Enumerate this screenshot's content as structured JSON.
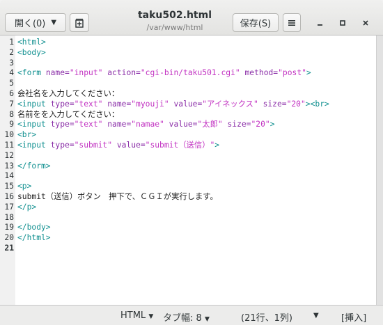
{
  "window": {
    "title": "taku502.html",
    "subtitle": "/var/www/html",
    "open_label": "開く(0)",
    "save_label": "保存(S)",
    "menu_icon": "hamburger-icon",
    "new_tab_icon": "new-document-icon"
  },
  "editor": {
    "current_line": 21,
    "lines": [
      {
        "n": "1",
        "parts": [
          {
            "c": "tag",
            "t": "<html>"
          }
        ]
      },
      {
        "n": "2",
        "parts": [
          {
            "c": "tag",
            "t": "<body>"
          }
        ]
      },
      {
        "n": "3",
        "parts": []
      },
      {
        "n": "4",
        "parts": [
          {
            "c": "tag",
            "t": "<form "
          },
          {
            "c": "attr",
            "t": "name="
          },
          {
            "c": "str",
            "t": "\"input\""
          },
          {
            "c": "attr",
            "t": " action="
          },
          {
            "c": "str",
            "t": "\"cgi-bin/taku501.cgi\""
          },
          {
            "c": "attr",
            "t": " method="
          },
          {
            "c": "str",
            "t": "\"post\""
          },
          {
            "c": "tag",
            "t": ">"
          }
        ]
      },
      {
        "n": "5",
        "parts": []
      },
      {
        "n": "6",
        "parts": [
          {
            "c": "txt",
            "t": "会社名を入力してください："
          }
        ]
      },
      {
        "n": "7",
        "parts": [
          {
            "c": "tag",
            "t": "<input "
          },
          {
            "c": "attr",
            "t": "type="
          },
          {
            "c": "str",
            "t": "\"text\""
          },
          {
            "c": "attr",
            "t": " name="
          },
          {
            "c": "str",
            "t": "\"myouji\""
          },
          {
            "c": "attr",
            "t": " value="
          },
          {
            "c": "str",
            "t": "\"アイネックス\""
          },
          {
            "c": "attr",
            "t": " size="
          },
          {
            "c": "str",
            "t": "\"20\""
          },
          {
            "c": "tag",
            "t": "><br>"
          }
        ]
      },
      {
        "n": "8",
        "parts": [
          {
            "c": "txt",
            "t": "名前をを入力してください："
          }
        ]
      },
      {
        "n": "9",
        "parts": [
          {
            "c": "tag",
            "t": "<input "
          },
          {
            "c": "attr",
            "t": "type="
          },
          {
            "c": "str",
            "t": "\"text\""
          },
          {
            "c": "attr",
            "t": " name="
          },
          {
            "c": "str",
            "t": "\"namae\""
          },
          {
            "c": "attr",
            "t": " value="
          },
          {
            "c": "str",
            "t": "\"太郎\""
          },
          {
            "c": "attr",
            "t": " size="
          },
          {
            "c": "str",
            "t": "\"20\""
          },
          {
            "c": "tag",
            "t": ">"
          }
        ]
      },
      {
        "n": "10",
        "parts": [
          {
            "c": "tag",
            "t": "<br>"
          }
        ]
      },
      {
        "n": "11",
        "parts": [
          {
            "c": "tag",
            "t": "<input "
          },
          {
            "c": "attr",
            "t": "type="
          },
          {
            "c": "str",
            "t": "\"submit\""
          },
          {
            "c": "attr",
            "t": " value="
          },
          {
            "c": "str",
            "t": "\"submit（送信）\""
          },
          {
            "c": "tag",
            "t": ">"
          }
        ]
      },
      {
        "n": "12",
        "parts": []
      },
      {
        "n": "13",
        "parts": [
          {
            "c": "tag",
            "t": "</form>"
          }
        ]
      },
      {
        "n": "14",
        "parts": []
      },
      {
        "n": "15",
        "parts": [
          {
            "c": "tag",
            "t": "<p>"
          }
        ]
      },
      {
        "n": "16",
        "parts": [
          {
            "c": "txt",
            "t": "submit（送信）ボタン　押下で、ＣＧＩが実行します。"
          }
        ]
      },
      {
        "n": "17",
        "parts": [
          {
            "c": "tag",
            "t": "</p>"
          }
        ]
      },
      {
        "n": "18",
        "parts": []
      },
      {
        "n": "19",
        "parts": [
          {
            "c": "tag",
            "t": "</body>"
          }
        ]
      },
      {
        "n": "20",
        "parts": [
          {
            "c": "tag",
            "t": "</html>"
          }
        ]
      },
      {
        "n": "21",
        "parts": []
      }
    ]
  },
  "statusbar": {
    "language": "HTML",
    "tab_width": "タブ幅: 8",
    "cursor_position": "(21行、1列)",
    "insert_mode": "[挿入]"
  }
}
